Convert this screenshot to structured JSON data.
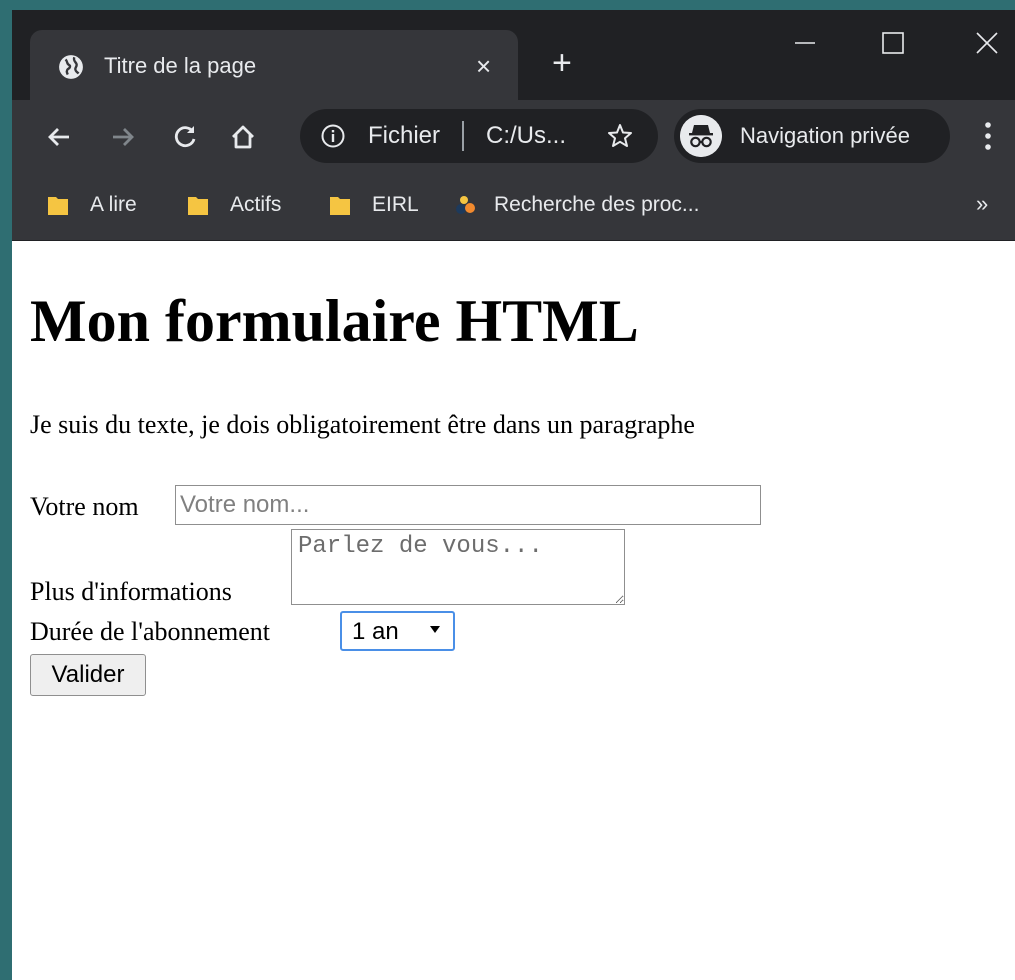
{
  "browser": {
    "tab": {
      "title": "Titre de la page",
      "favicon": "globe-icon",
      "close_label": "×"
    },
    "new_tab_label": "+",
    "window_controls": [
      "minimize-icon",
      "maximize-icon",
      "close-icon"
    ],
    "toolbar": {
      "icons": [
        "back-arrow-icon",
        "forward-arrow-icon",
        "reload-icon",
        "home-icon"
      ],
      "omnibox": {
        "scheme_label": "Fichier",
        "url": "C:/Us...",
        "info_icon": "info-icon",
        "star_icon": "star-icon"
      },
      "incognito_label": "Navigation privée",
      "menu_icon": "three-dots-icon"
    },
    "bookmarks": [
      {
        "label": "A lire",
        "icon": "folder-icon"
      },
      {
        "label": "Actifs",
        "icon": "folder-icon"
      },
      {
        "label": "EIRL",
        "icon": "folder-icon"
      },
      {
        "label": "Recherche des proc...",
        "icon": "site-icon"
      }
    ],
    "bookmarks_more": "»"
  },
  "page": {
    "heading": "Mon formulaire HTML",
    "paragraph": "Je suis du texte, je dois obligatoirement être dans un paragraphe",
    "form": {
      "name_label": "Votre nom",
      "name_placeholder": "Votre nom...",
      "name_value": "",
      "info_label": "Plus d'informations",
      "info_placeholder": "Parlez de vous...",
      "duration_label": "Durée de l'abonnement",
      "duration_selected": "1 an",
      "submit_label": "Valider"
    }
  },
  "colors": {
    "desktop": "#2f6e72",
    "tabstrip": "#202124",
    "toolbar": "#35363a",
    "text_light": "#e8eaed",
    "folder": "#f5c542",
    "select_focus": "#4a8fe7"
  }
}
